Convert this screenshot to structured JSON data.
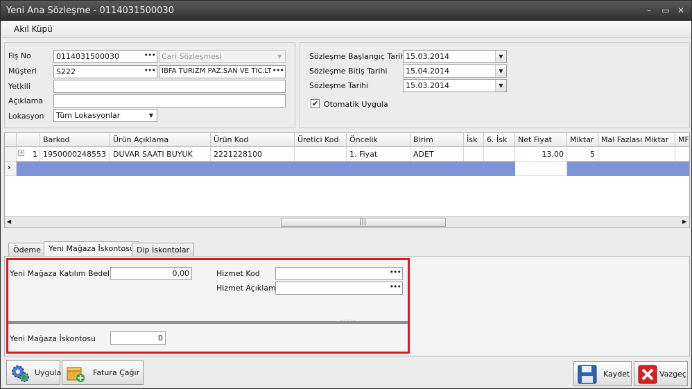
{
  "window": {
    "title": "Yeni Ana Sözleşme - 0114031500030"
  },
  "menu": {
    "item": "Akıl Küpü"
  },
  "header_left": {
    "fis_no_label": "Fiş No",
    "fis_no_value": "0114031500030",
    "cari_placeholder": "Cari Sözleşmesi",
    "musteri_label": "Müşteri",
    "musteri_code": "S222",
    "musteri_name": "IBFA TURIZM PAZ.SAN VE TIC.LT",
    "yetkili_label": "Yetkili",
    "yetkili_value": "",
    "aciklama_label": "Açıklama",
    "aciklama_value": "",
    "lokasyon_label": "Lokasyon",
    "lokasyon_value": "Tüm Lokasyonlar"
  },
  "header_right": {
    "start_label": "Sözleşme Başlangıç Tarihi",
    "start_value": "15.03.2014",
    "end_label": "Sözleşme Bitiş Tarihi",
    "end_value": "15.04.2014",
    "date_label": "Sözleşme Tarihi",
    "date_value": "15.03.2014",
    "auto_apply_label": "Otomatik Uygula",
    "auto_apply_checked": true
  },
  "grid": {
    "columns": [
      "Barkod",
      "Ürün Açıklama",
      "Ürün Kod",
      "Üretici Kod",
      "Öncelik",
      "Birim",
      "İsk",
      "6. İsk",
      "Net Fiyat",
      "Miktar",
      "Mal Fazlası Miktar",
      "MF"
    ],
    "rows": [
      {
        "no": "1",
        "barkod": "1950000248553",
        "urun_aciklama": "DUVAR SAATI BUYUK",
        "urun_kod": "2221228100",
        "uretici_kod": "",
        "oncelik": "1. Fiyat",
        "birim": "ADET",
        "isk": "",
        "isk6": "",
        "net_fiyat": "13,00",
        "miktar": "5",
        "mal_fazlasi": "",
        "mf": ""
      }
    ]
  },
  "tabs": [
    {
      "label": "Ödeme",
      "active": false
    },
    {
      "label": "Yeni Mağaza İskontosu",
      "active": true
    },
    {
      "label": "Dip İskontolar",
      "active": false
    }
  ],
  "tab_content": {
    "katilim_label": "Yeni Mağaza Katılım Bedeli",
    "katilim_value": "0,00",
    "hizmet_kod_label": "Hizmet Kod",
    "hizmet_kod_value": "",
    "hizmet_aciklama_label": "Hizmet Açıklama",
    "hizmet_aciklama_value": "",
    "iskonto_label": "Yeni Mağaza İskontosu",
    "iskonto_value": "0"
  },
  "buttons": {
    "uygula": "Uygula",
    "fatura_cagir": "Fatura Çağır",
    "kaydet": "Kaydet",
    "vazgec": "Vazgeç"
  },
  "colors": {
    "highlight_row": "#7d94d9",
    "red_box": "#e0161f"
  }
}
